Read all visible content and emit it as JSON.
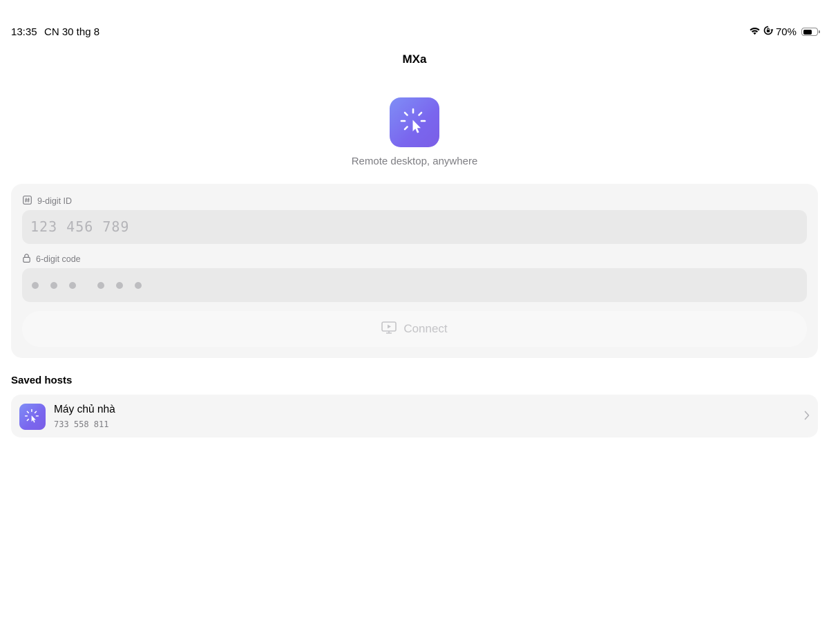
{
  "status_bar": {
    "time": "13:35",
    "date": "CN 30 thg 8",
    "battery_percent": "70%",
    "battery_level": 0.7,
    "icons": [
      "wifi-icon",
      "screen-rotation-lock-icon",
      "battery-icon"
    ]
  },
  "nav": {
    "title": "MXa"
  },
  "hero": {
    "tagline": "Remote desktop, anywhere",
    "icon": "app-logo-cursor-icon"
  },
  "form": {
    "id_label": "9-digit ID",
    "id_label_icon": "hash-icon",
    "id_placeholder": "123 456 789",
    "code_label": "6-digit code",
    "code_label_icon": "lock-icon",
    "code_placeholder_dots": 6,
    "connect_label": "Connect",
    "connect_icon": "screen-play-icon",
    "connect_enabled": false
  },
  "saved_hosts": {
    "title": "Saved hosts",
    "items": [
      {
        "name": "Máy chủ nhà",
        "id": "733 558 811",
        "icon": "app-logo-cursor-icon",
        "accessory": "chevron-right-icon"
      }
    ]
  },
  "colors": {
    "accent_gradient_start": "#7f8ef6",
    "accent_gradient_end": "#7b5ee6",
    "card_background": "#f5f5f5",
    "input_background": "#e9e9e9",
    "secondary_text": "#7d7d82"
  }
}
